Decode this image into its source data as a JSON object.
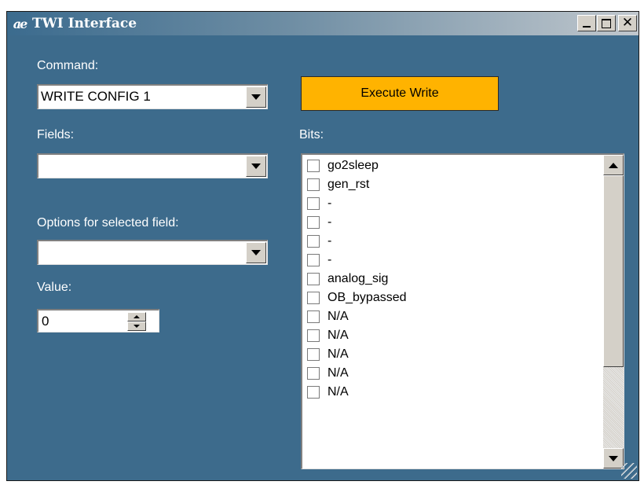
{
  "window": {
    "title": "TWI Interface",
    "icon": "ae-logo-icon",
    "buttons": [
      "minimize",
      "maximize",
      "close"
    ]
  },
  "command": {
    "label": "Command:",
    "selected": "WRITE CONFIG 1"
  },
  "execute_button": {
    "label": "Execute Write",
    "color": "#ffb300"
  },
  "fields": {
    "label": "Fields:",
    "selected": ""
  },
  "options": {
    "label": "Options for selected field:",
    "selected": ""
  },
  "value": {
    "label": "Value:",
    "current": "0"
  },
  "bits": {
    "label": "Bits:",
    "items": [
      {
        "label": "go2sleep",
        "checked": false
      },
      {
        "label": "gen_rst",
        "checked": false
      },
      {
        "label": "-",
        "checked": false
      },
      {
        "label": "-",
        "checked": false
      },
      {
        "label": "-",
        "checked": false
      },
      {
        "label": "-",
        "checked": false
      },
      {
        "label": "analog_sig",
        "checked": false
      },
      {
        "label": "OB_bypassed",
        "checked": false
      },
      {
        "label": "N/A",
        "checked": false
      },
      {
        "label": "N/A",
        "checked": false
      },
      {
        "label": "N/A",
        "checked": false
      },
      {
        "label": "N/A",
        "checked": false
      },
      {
        "label": "N/A",
        "checked": false
      }
    ]
  },
  "colors": {
    "window_background": "#3d6b8c"
  }
}
